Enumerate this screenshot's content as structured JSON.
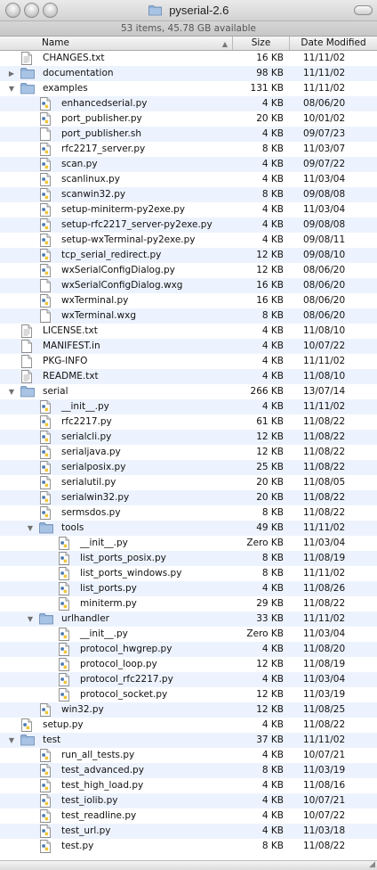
{
  "window": {
    "title": "pyserial-2.6",
    "status": "53 items, 45.78 GB available"
  },
  "columns": {
    "name": "Name",
    "size": "Size",
    "date": "Date Modified",
    "sort_indicator": "▲"
  },
  "icons": {
    "file": "document-icon",
    "py": "python-file-icon",
    "text": "text-document-icon",
    "folder": "folder-icon",
    "disclosure_open": "▼",
    "disclosure_closed": "▶"
  },
  "resize_glyph": "◢",
  "rows": [
    {
      "depth": 0,
      "type": "txt",
      "name": "CHANGES.txt",
      "size": "16 KB",
      "date": "11/11/02"
    },
    {
      "depth": 0,
      "type": "folder",
      "state": "closed",
      "name": "documentation",
      "size": "98 KB",
      "date": "11/11/02"
    },
    {
      "depth": 0,
      "type": "folder",
      "state": "open",
      "name": "examples",
      "size": "131 KB",
      "date": "11/11/02"
    },
    {
      "depth": 1,
      "type": "py",
      "name": "enhancedserial.py",
      "size": "4 KB",
      "date": "08/06/20"
    },
    {
      "depth": 1,
      "type": "py",
      "name": "port_publisher.py",
      "size": "20 KB",
      "date": "10/01/02"
    },
    {
      "depth": 1,
      "type": "file",
      "name": "port_publisher.sh",
      "size": "4 KB",
      "date": "09/07/23"
    },
    {
      "depth": 1,
      "type": "py",
      "name": "rfc2217_server.py",
      "size": "8 KB",
      "date": "11/03/07"
    },
    {
      "depth": 1,
      "type": "py",
      "name": "scan.py",
      "size": "4 KB",
      "date": "09/07/22"
    },
    {
      "depth": 1,
      "type": "py",
      "name": "scanlinux.py",
      "size": "4 KB",
      "date": "11/03/04"
    },
    {
      "depth": 1,
      "type": "py",
      "name": "scanwin32.py",
      "size": "8 KB",
      "date": "09/08/08"
    },
    {
      "depth": 1,
      "type": "py",
      "name": "setup-miniterm-py2exe.py",
      "size": "4 KB",
      "date": "11/03/04"
    },
    {
      "depth": 1,
      "type": "py",
      "name": "setup-rfc2217_server-py2exe.py",
      "size": "4 KB",
      "date": "09/08/08"
    },
    {
      "depth": 1,
      "type": "py",
      "name": "setup-wxTerminal-py2exe.py",
      "size": "4 KB",
      "date": "09/08/11"
    },
    {
      "depth": 1,
      "type": "py",
      "name": "tcp_serial_redirect.py",
      "size": "12 KB",
      "date": "09/08/10"
    },
    {
      "depth": 1,
      "type": "py",
      "name": "wxSerialConfigDialog.py",
      "size": "12 KB",
      "date": "08/06/20"
    },
    {
      "depth": 1,
      "type": "file",
      "name": "wxSerialConfigDialog.wxg",
      "size": "16 KB",
      "date": "08/06/20"
    },
    {
      "depth": 1,
      "type": "py",
      "name": "wxTerminal.py",
      "size": "16 KB",
      "date": "08/06/20"
    },
    {
      "depth": 1,
      "type": "file",
      "name": "wxTerminal.wxg",
      "size": "8 KB",
      "date": "08/06/20"
    },
    {
      "depth": 0,
      "type": "txt",
      "name": "LICENSE.txt",
      "size": "4 KB",
      "date": "11/08/10"
    },
    {
      "depth": 0,
      "type": "file",
      "name": "MANIFEST.in",
      "size": "4 KB",
      "date": "10/07/22"
    },
    {
      "depth": 0,
      "type": "file",
      "name": "PKG-INFO",
      "size": "4 KB",
      "date": "11/11/02"
    },
    {
      "depth": 0,
      "type": "txt",
      "name": "README.txt",
      "size": "4 KB",
      "date": "11/08/10"
    },
    {
      "depth": 0,
      "type": "folder",
      "state": "open",
      "name": "serial",
      "size": "266 KB",
      "date": "13/07/14"
    },
    {
      "depth": 1,
      "type": "py",
      "name": "__init__.py",
      "size": "4 KB",
      "date": "11/11/02"
    },
    {
      "depth": 1,
      "type": "py",
      "name": "rfc2217.py",
      "size": "61 KB",
      "date": "11/08/22"
    },
    {
      "depth": 1,
      "type": "py",
      "name": "serialcli.py",
      "size": "12 KB",
      "date": "11/08/22"
    },
    {
      "depth": 1,
      "type": "py",
      "name": "serialjava.py",
      "size": "12 KB",
      "date": "11/08/22"
    },
    {
      "depth": 1,
      "type": "py",
      "name": "serialposix.py",
      "size": "25 KB",
      "date": "11/08/22"
    },
    {
      "depth": 1,
      "type": "py",
      "name": "serialutil.py",
      "size": "20 KB",
      "date": "11/08/05"
    },
    {
      "depth": 1,
      "type": "py",
      "name": "serialwin32.py",
      "size": "20 KB",
      "date": "11/08/22"
    },
    {
      "depth": 1,
      "type": "py",
      "name": "sermsdos.py",
      "size": "8 KB",
      "date": "11/08/22"
    },
    {
      "depth": 1,
      "type": "folder",
      "state": "open",
      "name": "tools",
      "size": "49 KB",
      "date": "11/11/02"
    },
    {
      "depth": 2,
      "type": "py",
      "name": "__init__.py",
      "size": "Zero KB",
      "date": "11/03/04"
    },
    {
      "depth": 2,
      "type": "py",
      "name": "list_ports_posix.py",
      "size": "8 KB",
      "date": "11/08/19"
    },
    {
      "depth": 2,
      "type": "py",
      "name": "list_ports_windows.py",
      "size": "8 KB",
      "date": "11/11/02"
    },
    {
      "depth": 2,
      "type": "py",
      "name": "list_ports.py",
      "size": "4 KB",
      "date": "11/08/26"
    },
    {
      "depth": 2,
      "type": "py",
      "name": "miniterm.py",
      "size": "29 KB",
      "date": "11/08/22"
    },
    {
      "depth": 1,
      "type": "folder",
      "state": "open",
      "name": "urlhandler",
      "size": "33 KB",
      "date": "11/11/02"
    },
    {
      "depth": 2,
      "type": "py",
      "name": "__init__.py",
      "size": "Zero KB",
      "date": "11/03/04"
    },
    {
      "depth": 2,
      "type": "py",
      "name": "protocol_hwgrep.py",
      "size": "4 KB",
      "date": "11/08/20"
    },
    {
      "depth": 2,
      "type": "py",
      "name": "protocol_loop.py",
      "size": "12 KB",
      "date": "11/08/19"
    },
    {
      "depth": 2,
      "type": "py",
      "name": "protocol_rfc2217.py",
      "size": "4 KB",
      "date": "11/03/04"
    },
    {
      "depth": 2,
      "type": "py",
      "name": "protocol_socket.py",
      "size": "12 KB",
      "date": "11/03/19"
    },
    {
      "depth": 1,
      "type": "py",
      "name": "win32.py",
      "size": "12 KB",
      "date": "11/08/25"
    },
    {
      "depth": 0,
      "type": "py",
      "name": "setup.py",
      "size": "4 KB",
      "date": "11/08/22"
    },
    {
      "depth": 0,
      "type": "folder",
      "state": "open",
      "name": "test",
      "size": "37 KB",
      "date": "11/11/02"
    },
    {
      "depth": 1,
      "type": "py",
      "name": "run_all_tests.py",
      "size": "4 KB",
      "date": "10/07/21"
    },
    {
      "depth": 1,
      "type": "py",
      "name": "test_advanced.py",
      "size": "8 KB",
      "date": "11/03/19"
    },
    {
      "depth": 1,
      "type": "py",
      "name": "test_high_load.py",
      "size": "4 KB",
      "date": "11/08/16"
    },
    {
      "depth": 1,
      "type": "py",
      "name": "test_iolib.py",
      "size": "4 KB",
      "date": "10/07/21"
    },
    {
      "depth": 1,
      "type": "py",
      "name": "test_readline.py",
      "size": "4 KB",
      "date": "10/07/22"
    },
    {
      "depth": 1,
      "type": "py",
      "name": "test_url.py",
      "size": "4 KB",
      "date": "11/03/18"
    },
    {
      "depth": 1,
      "type": "py",
      "name": "test.py",
      "size": "8 KB",
      "date": "11/08/22"
    }
  ]
}
